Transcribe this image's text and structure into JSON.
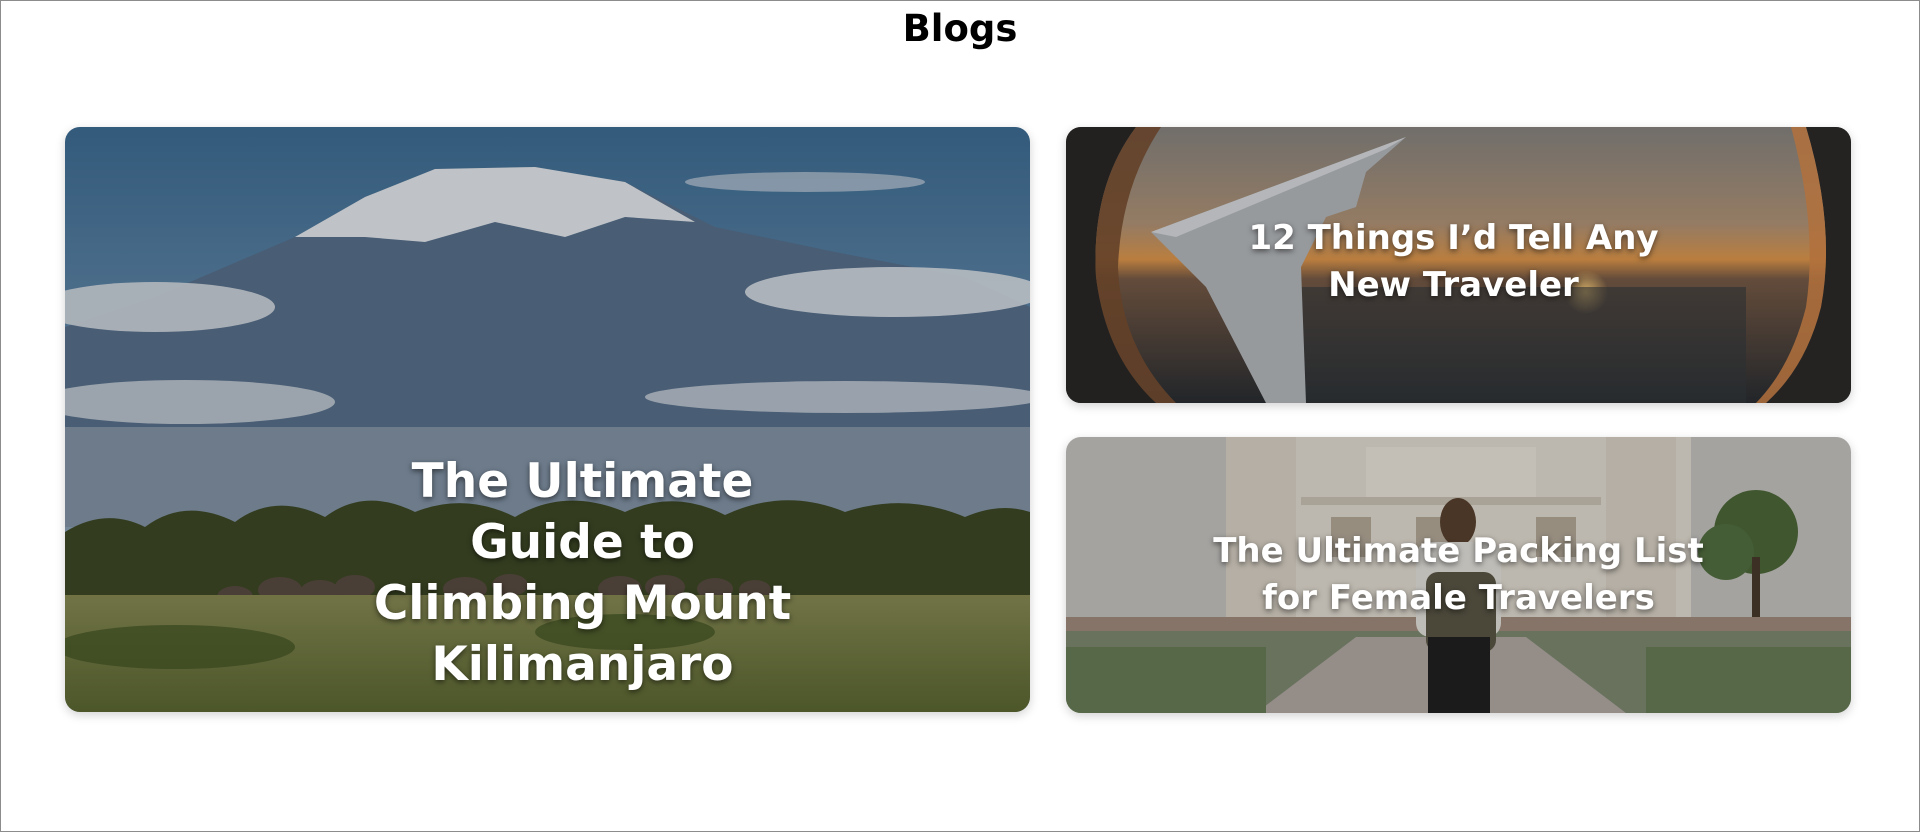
{
  "page": {
    "title": "Blogs"
  },
  "blogs": [
    {
      "title": "The Ultimate Guide to Climbing Mount Kilimanjaro",
      "image": "mount-kilimanjaro-savanna-elephants"
    },
    {
      "title": "12 Things I’d Tell Any New Traveler",
      "image": "airplane-window-wing-sunset"
    },
    {
      "title": "The Ultimate Packing List for Female Travelers",
      "image": "female-traveler-backpack-monument"
    }
  ],
  "colors": {
    "background": "#ffffff",
    "title_text": "#000000",
    "card_text": "#ffffff",
    "frame_border": "#8c8c8c"
  }
}
